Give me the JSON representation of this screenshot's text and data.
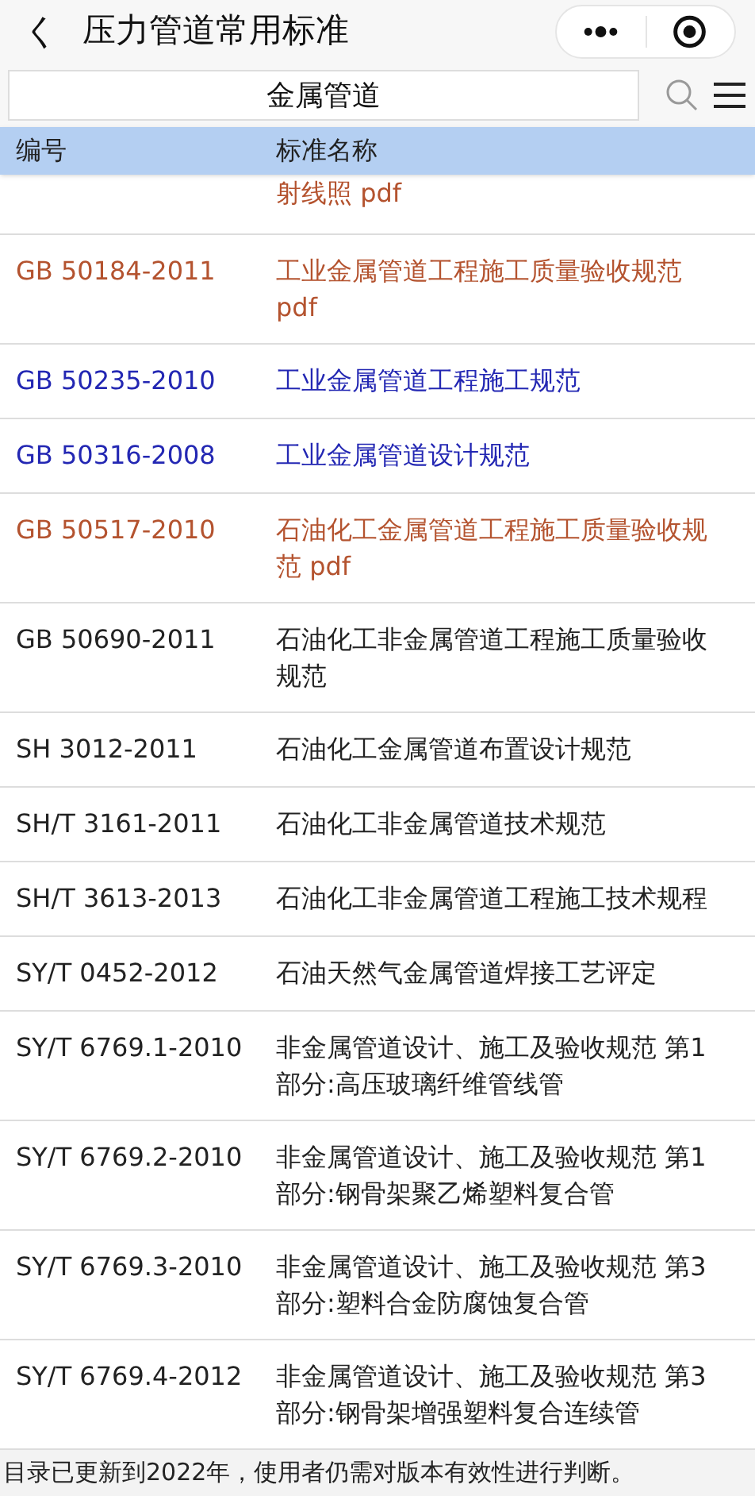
{
  "header": {
    "back": "く",
    "title": "压力管道常用标准"
  },
  "search": {
    "value": "金属管道"
  },
  "table": {
    "columns": [
      "编号",
      "标准名称"
    ],
    "rows": [
      {
        "code": "",
        "name": "射线照 pdf",
        "color": "#b4532f",
        "kind": "clipped"
      },
      {
        "code": "GB 50184-2011",
        "name": "工业金属管道工程施工质量验收规范pdf",
        "color": "#b4532f"
      },
      {
        "code": "GB 50235-2010",
        "name": "工业金属管道工程施工规范",
        "color": "#2327b3"
      },
      {
        "code": "GB 50316-2008",
        "name": "工业金属管道设计规范",
        "color": "#2327b3"
      },
      {
        "code": "GB 50517-2010",
        "name": "石油化工金属管道工程施工质量验收规范 pdf",
        "color": "#b4532f"
      },
      {
        "code": "GB 50690-2011",
        "name": "石油化工非金属管道工程施工质量验收规范",
        "color": "#222222"
      },
      {
        "code": "SH 3012-2011",
        "name": "石油化工金属管道布置设计规范",
        "color": "#222222"
      },
      {
        "code": "SH/T 3161-2011",
        "name": "石油化工非金属管道技术规范",
        "color": "#222222"
      },
      {
        "code": "SH/T 3613-2013",
        "name": "石油化工非金属管道工程施工技术规程",
        "color": "#222222"
      },
      {
        "code": "SY/T 0452-2012",
        "name": "石油天然气金属管道焊接工艺评定",
        "color": "#222222"
      },
      {
        "code": "SY/T 6769.1-2010",
        "name": "非金属管道设计、施工及验收规范 第1部分:高压玻璃纤维管线管",
        "color": "#222222"
      },
      {
        "code": "SY/T 6769.2-2010",
        "name": "非金属管道设计、施工及验收规范 第1部分:钢骨架聚乙烯塑料复合管",
        "color": "#222222"
      },
      {
        "code": "SY/T 6769.3-2010",
        "name": "非金属管道设计、施工及验收规范 第3部分:塑料合金防腐蚀复合管",
        "color": "#222222"
      },
      {
        "code": "SY/T 6769.4-2012",
        "name": "非金属管道设计、施工及验收规范 第3部分:钢骨架增强塑料复合连续管",
        "color": "#222222"
      }
    ]
  },
  "footer": "目录已更新到2022年，使用者仍需对版本有效性进行判断。"
}
